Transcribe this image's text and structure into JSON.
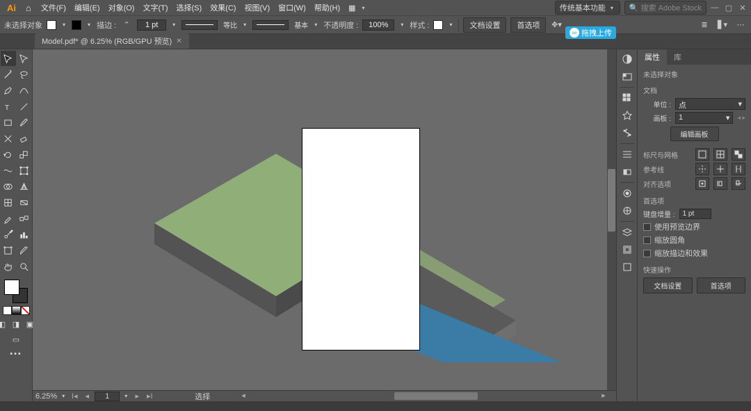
{
  "menu": {
    "logo": "Ai",
    "items": [
      "文件(F)",
      "编辑(E)",
      "对象(O)",
      "文字(T)",
      "选择(S)",
      "效果(C)",
      "视图(V)",
      "窗口(W)",
      "帮助(H)"
    ],
    "bridge": "▦",
    "workspace_label": "传统基本功能",
    "search_placeholder": "搜索 Adobe Stock"
  },
  "options": {
    "selection_label": "未选择对象",
    "stroke_label": "描边 :",
    "stroke_value": "1 pt",
    "dash1_label": "等比",
    "dash2_label": "基本",
    "opacity_label": "不透明度 :",
    "opacity_value": "100%",
    "style_label": "样式 :",
    "docset_btn": "文档设置",
    "prefs_btn": "首选项"
  },
  "tab": {
    "title": "Model.pdf* @ 6.25% (RGB/GPU 预览)"
  },
  "status": {
    "zoom": "6.25%",
    "artboard": "1",
    "select_label": "选择"
  },
  "upload_pill": "拖拽上传",
  "panel": {
    "tabs": [
      "属性",
      "库"
    ],
    "no_selection": "未选择对象",
    "doc_section": "文档",
    "units_label": "单位 :",
    "units_value": "点",
    "artboard_label": "画板 :",
    "artboard_value": "1",
    "edit_artboard_btn": "编辑画板",
    "ruler_grid": "标尺与网格",
    "guides": "参考线",
    "align_opts": "对齐选项",
    "prefs_section": "首选项",
    "kb_increment_label": "键盘增量 :",
    "kb_increment_value": "1 pt",
    "chk1": "使用预览边界",
    "chk2": "缩放圆角",
    "chk3": "缩放描边和效果",
    "quick_section": "快速操作",
    "quick_btn1": "文档设置",
    "quick_btn2": "首选项"
  }
}
